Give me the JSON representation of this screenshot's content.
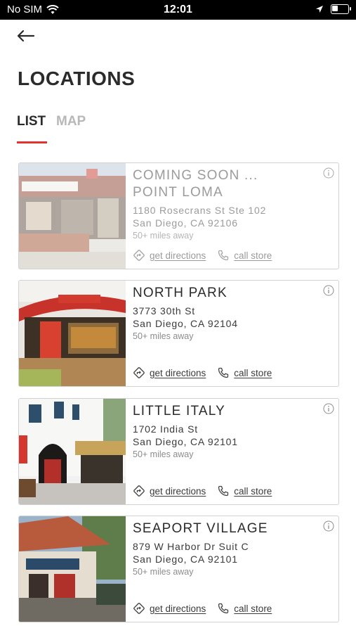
{
  "status_bar": {
    "carrier": "No SIM",
    "time": "12:01"
  },
  "header": {
    "title": "LOCATIONS"
  },
  "tabs": [
    {
      "label": "LIST",
      "active": true
    },
    {
      "label": "MAP",
      "active": false
    }
  ],
  "colors": {
    "accent": "#e4332f"
  },
  "locations": [
    {
      "title_lines": [
        "COMING SOON ...",
        "POINT LOMA"
      ],
      "address1": "1180 Rosecrans St Ste 102",
      "address2": "San Diego, CA 92106",
      "distance": "50+ miles away",
      "directions_label": "get directions",
      "call_label": "call store",
      "coming_soon": true
    },
    {
      "title_lines": [
        "NORTH PARK"
      ],
      "address1": "3773 30th St",
      "address2": "San Diego, CA 92104",
      "distance": "50+ miles away",
      "directions_label": "get directions",
      "call_label": "call store",
      "coming_soon": false
    },
    {
      "title_lines": [
        "LITTLE ITALY"
      ],
      "address1": "1702 India St",
      "address2": "San Diego, CA 92101",
      "distance": "50+ miles away",
      "directions_label": "get directions",
      "call_label": "call store",
      "coming_soon": false
    },
    {
      "title_lines": [
        "SEAPORT VILLAGE"
      ],
      "address1": "879 W Harbor Dr Suit C",
      "address2": "San Diego, CA 92101",
      "distance": "50+ miles away",
      "directions_label": "get directions",
      "call_label": "call store",
      "coming_soon": false
    }
  ]
}
